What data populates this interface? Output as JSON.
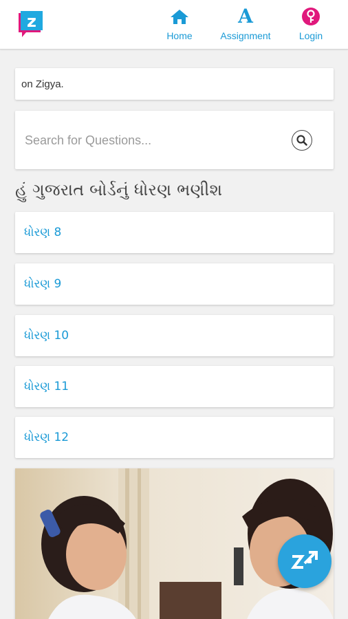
{
  "header": {
    "logo_letter": "z",
    "nav": [
      {
        "label": "Home",
        "icon": "home-icon"
      },
      {
        "label": "Assignment",
        "icon": "assignment-icon"
      },
      {
        "label": "Login",
        "icon": "key-icon"
      }
    ]
  },
  "notice": {
    "text": "on Zigya."
  },
  "search": {
    "placeholder": "Search for Questions...",
    "value": ""
  },
  "heading": "હું ગુજરાત બોર્ડનું ધોરણ ભણીશ",
  "grades": [
    {
      "label": "ધોરણ 8"
    },
    {
      "label": "ધોરણ 9"
    },
    {
      "label": "ધોરણ 10"
    },
    {
      "label": "ધોરણ 11"
    },
    {
      "label": "ધોરણ 12"
    }
  ],
  "colors": {
    "accent": "#1a9ad6",
    "logo_blue": "#20a9e0",
    "logo_pink": "#e0187c",
    "fab": "#2aa3dd",
    "background": "#f1f1f1"
  },
  "fab": {
    "icon": "zigya-fab-icon"
  }
}
